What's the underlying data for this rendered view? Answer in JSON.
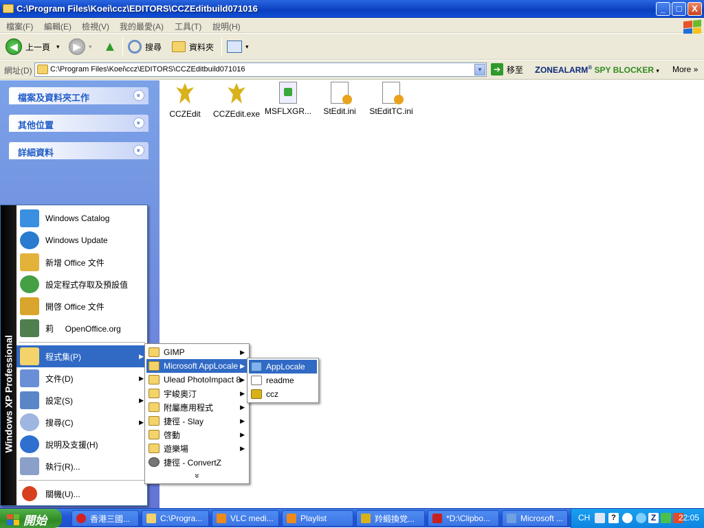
{
  "window": {
    "title": "C:\\Program Files\\Koei\\ccz\\EDITORS\\CCZEditbuild071016",
    "buttons": {
      "minimize": "_",
      "maximize": "□",
      "close": "X"
    }
  },
  "menubar": [
    "檔案(F)",
    "編輯(E)",
    "檢視(V)",
    "我的最愛(A)",
    "工具(T)",
    "說明(H)"
  ],
  "toolbar": {
    "back": "上一頁",
    "search": "搜尋",
    "folders": "資料夾",
    "back_arrow": "◀",
    "forward_arrow": "▶",
    "up_arrow": "▲",
    "drop": "▾"
  },
  "address": {
    "label": "網址(D)",
    "value": "C:\\Program Files\\Koei\\ccz\\EDITORS\\CCZEditbuild071016",
    "go": "移至",
    "go_arrow": "➔"
  },
  "zonealarm": {
    "z": "Z",
    "zone": "ONEALARM",
    "reg": "®",
    "spy": "SPY BLOCKER",
    "drop": "▾"
  },
  "more": "More",
  "more_chev": "»",
  "tasks": [
    {
      "label": "檔案及資料夾工作"
    },
    {
      "label": "其他位置"
    },
    {
      "label": "詳細資料"
    }
  ],
  "chevron": "»",
  "files": [
    {
      "name": "CCZEdit",
      "icon": "bird-shortcut-icon"
    },
    {
      "name": "CCZEdit.exe",
      "icon": "bird-icon"
    },
    {
      "name": "MSFLXGR...",
      "icon": "dll-icon"
    },
    {
      "name": "StEdit.ini",
      "icon": "ini-icon"
    },
    {
      "name": "StEditTC.ini",
      "icon": "ini-icon"
    }
  ],
  "startmenu": {
    "banner": "Windows XP  Professional",
    "top_items": [
      {
        "label": "Windows Catalog",
        "color": "#3b8fe0"
      },
      {
        "label": "Windows Update",
        "color": "#2a7ad0"
      },
      {
        "label": "新增 Office 文件",
        "color": "#e2b23a"
      },
      {
        "label": "設定程式存取及預設值",
        "color": "#45a045"
      },
      {
        "label": "開啓 Office 文件",
        "color": "#d9a52c"
      },
      {
        "label": "莉     OpenOffice.org",
        "color": "#4f7f4f"
      }
    ],
    "items": [
      {
        "label": "程式集(P)",
        "color": "#f3d36a",
        "arrow": "▶"
      },
      {
        "label": "文件(D)",
        "color": "#6b8fd6",
        "arrow": "▶"
      },
      {
        "label": "設定(S)",
        "color": "#5a86c8",
        "arrow": "▶"
      },
      {
        "label": "搜尋(C)",
        "color": "#9fb6e0",
        "arrow": "▶"
      },
      {
        "label": "說明及支援(H)",
        "color": "#2f6fd0",
        "arrow": ""
      },
      {
        "label": "執行(R)...",
        "color": "#8aa0c8",
        "arrow": ""
      }
    ],
    "shutdown": "關機(U)...",
    "shutdown_color": "#d6401f"
  },
  "programs": [
    {
      "label": "GIMP",
      "arrow": "▶"
    },
    {
      "label": "Microsoft AppLocale",
      "arrow": "▶"
    },
    {
      "label": "Ulead PhotoImpact 8",
      "arrow": "▶"
    },
    {
      "label": "宇峻奧汀",
      "arrow": "▶"
    },
    {
      "label": "附屬應用程式",
      "arrow": "▶"
    },
    {
      "label": "捷徑 - Slay",
      "arrow": "▶"
    },
    {
      "label": "啓動",
      "arrow": "▶"
    },
    {
      "label": "遊樂場",
      "arrow": "▶"
    },
    {
      "label": "捷徑 - ConvertZ",
      "arrow": ""
    }
  ],
  "programs_more": "»",
  "applocale": [
    {
      "label": "AppLocale"
    },
    {
      "label": "readme"
    },
    {
      "label": "ccz"
    }
  ],
  "taskbar": {
    "start": "開始",
    "buttons": [
      {
        "label": "香港三國...",
        "color": "#d62020"
      },
      {
        "label": "C:\\Progra...",
        "color": "#f3d36a"
      },
      {
        "label": "VLC medi...",
        "color": "#f08a1a"
      },
      {
        "label": "Playlist",
        "color": "#f08a1a"
      },
      {
        "label": "羚緞換党...",
        "color": "#d9b21a"
      },
      {
        "label": "*D:\\Clipbo...",
        "color": "#c82020"
      },
      {
        "label": "Microsoft ...",
        "color": "#6fa0e0"
      }
    ],
    "lang": "CH",
    "help": "?",
    "tray_z": "Z",
    "time": "22:05"
  }
}
